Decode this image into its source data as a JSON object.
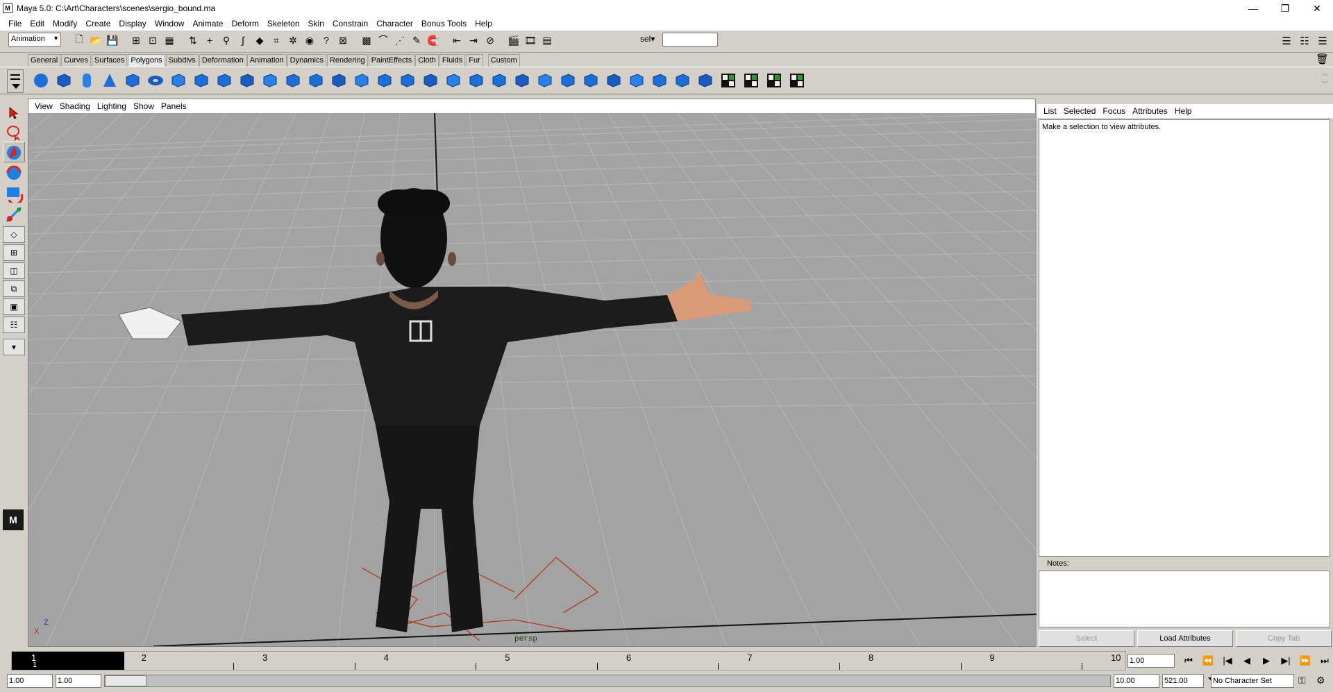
{
  "window": {
    "title": "Maya 5.0: C:\\Art\\Characters\\scenes\\sergio_bound.ma",
    "app_icon": "M"
  },
  "menubar": {
    "items": [
      "File",
      "Edit",
      "Modify",
      "Create",
      "Display",
      "Window",
      "Animate",
      "Deform",
      "Skeleton",
      "Skin",
      "Constrain",
      "Character",
      "Bonus Tools",
      "Help"
    ]
  },
  "statusline": {
    "mode": "Animation",
    "sel_label": "sel▾",
    "sel_value": ""
  },
  "shelf": {
    "tabs": [
      "General",
      "Curves",
      "Surfaces",
      "Polygons",
      "Subdivs",
      "Deformation",
      "Animation",
      "Dynamics",
      "Rendering",
      "PaintEffects",
      "Cloth",
      "Fluids",
      "Fur",
      "Custom"
    ],
    "active_tab": "Polygons"
  },
  "viewport": {
    "panel_menu": [
      "View",
      "Shading",
      "Lighting",
      "Show",
      "Panels"
    ],
    "camera_label": "persp",
    "axis_z": "Z",
    "axis_x": "X",
    "logo_text": "M"
  },
  "attribute_editor": {
    "menu": [
      "List",
      "Selected",
      "Focus",
      "Attributes",
      "Help"
    ],
    "message": "Make a selection to view attributes.",
    "notes_label": "Notes:",
    "buttons": {
      "select": "Select",
      "load": "Load Attributes",
      "copy": "Copy Tab"
    }
  },
  "timeslider": {
    "current_frame": "1",
    "current_frame_sub": "1",
    "ticks": [
      "2",
      "3",
      "4",
      "5",
      "6",
      "7",
      "8",
      "9",
      "10"
    ],
    "current_time": "1.00"
  },
  "rangeslider": {
    "start": "1.00",
    "playback_start": "1.00",
    "playback_end": "10.00",
    "end": "521.00",
    "character_set": "No Character Set"
  },
  "colors": {
    "ui_bg": "#d4d0c8",
    "viewport_bg": "#a3a3a3",
    "grid": "#b8b8b8",
    "shelf_blue": "#1e6ed8"
  }
}
